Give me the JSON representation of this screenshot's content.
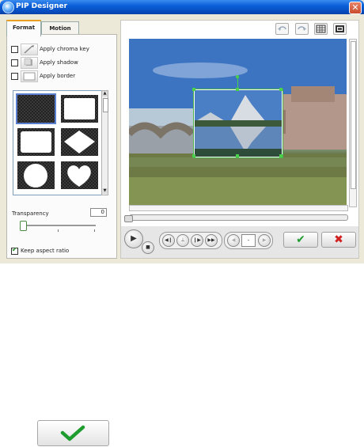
{
  "window": {
    "title": "PIP Designer"
  },
  "tabs": [
    {
      "label": "Format"
    },
    {
      "label": "Motion"
    }
  ],
  "options": [
    {
      "label": "Apply chroma key",
      "checked": false
    },
    {
      "label": "Apply shadow",
      "checked": false
    },
    {
      "label": "Apply border",
      "checked": false
    }
  ],
  "frames": [
    "rectangle-checker",
    "rectangle",
    "rounded-rectangle",
    "diamond",
    "circle",
    "heart"
  ],
  "transparency": {
    "label": "Transparency",
    "value": "0",
    "level": 0
  },
  "keep_aspect": {
    "label": "Keep aspect ratio",
    "checked": true
  },
  "playback": {
    "time_value": "-"
  },
  "colors": {
    "accent_ok": "#1e9c2e",
    "accent_cancel": "#d02020",
    "title_bar": "#0a5fd8"
  }
}
